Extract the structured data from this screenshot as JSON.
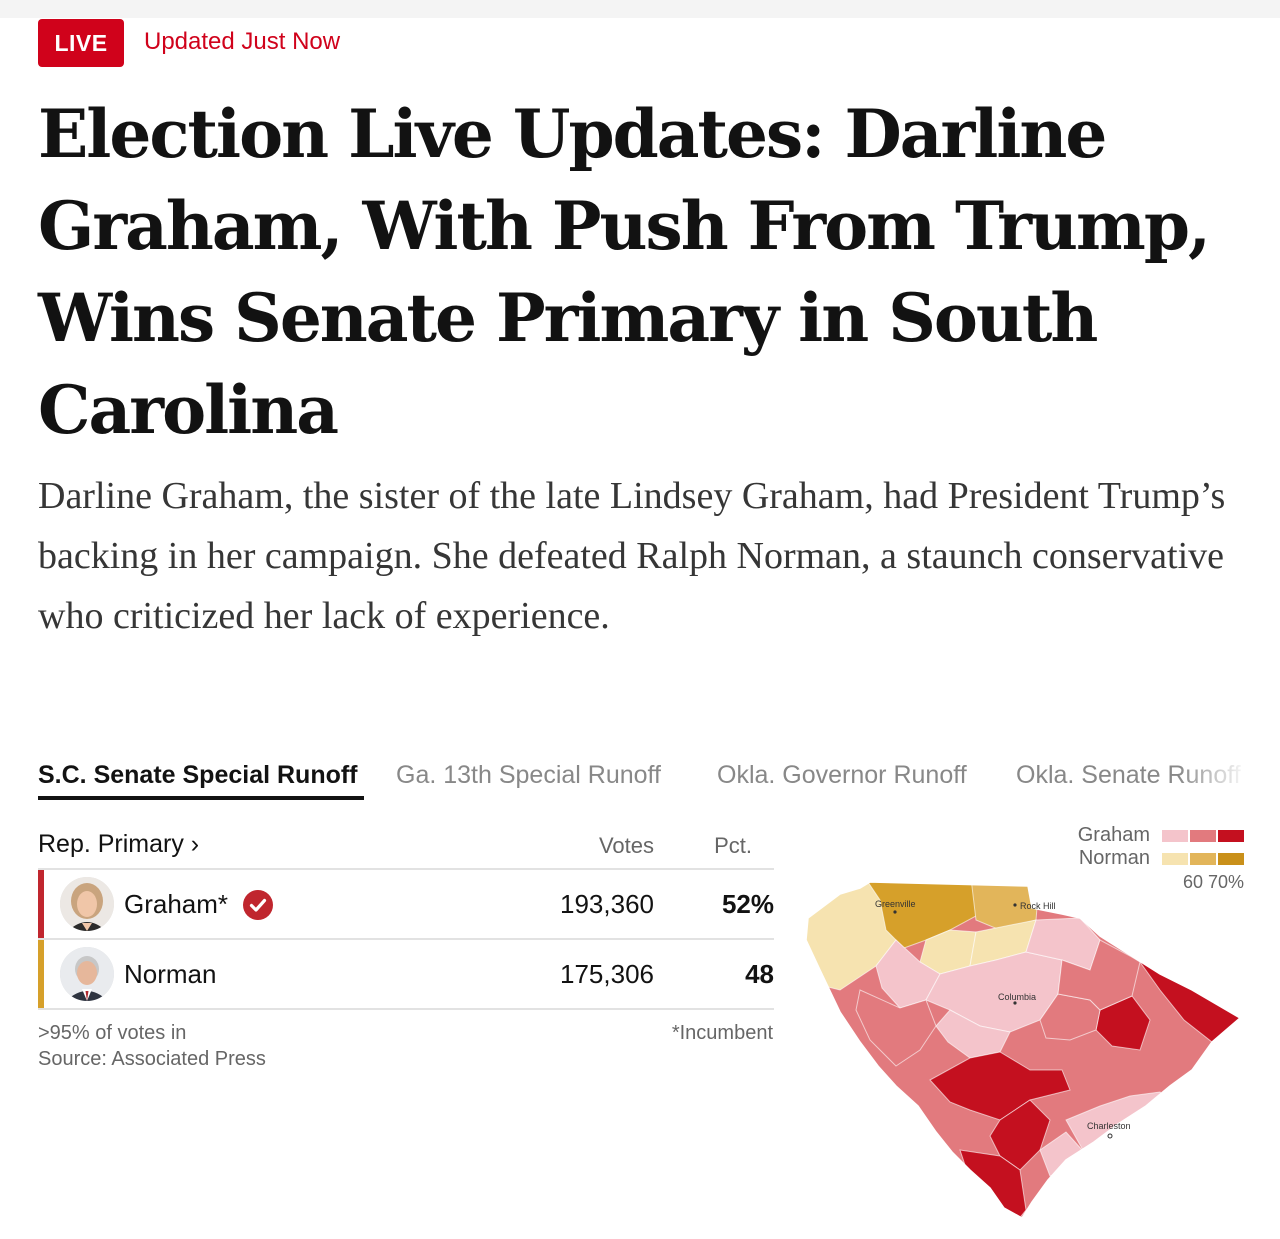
{
  "header": {
    "live_badge": "LIVE",
    "updated": "Updated Just Now"
  },
  "article": {
    "headline": "Election Live Updates: Darline Graham, With Push From Trump, Wins Senate Primary in South Carolina",
    "dek": "Darline Graham, the sister of the late Lindsey Graham, had President Trump’s backing in her campaign. She defeated Ralph Norman, a staunch conservative who criticized her lack of experience."
  },
  "race_tabs": [
    {
      "label": "S.C. Senate Special Runoff",
      "active": true
    },
    {
      "label": "Ga. 13th Special Runoff",
      "active": false
    },
    {
      "label": "Okla. Governor Runoff",
      "active": false
    },
    {
      "label": "Okla. Senate Runoff",
      "active": false
    }
  ],
  "results": {
    "primary_label": "Rep. Primary ›",
    "columns": {
      "votes": "Votes",
      "pct": "Pct."
    },
    "candidates": [
      {
        "name": "Graham*",
        "votes": "193,360",
        "pct": "52%",
        "winner": true,
        "color": "#c0262e"
      },
      {
        "name": "Norman",
        "votes": "175,306",
        "pct": "48",
        "winner": false,
        "color": "#d6a02a"
      }
    ],
    "reporting": ">95% of votes in",
    "source": "Source: Associated Press",
    "incumbent_note": "*Incumbent"
  },
  "map": {
    "legend": {
      "graham_label": "Graham",
      "norman_label": "Norman",
      "scale": "60 70%",
      "graham_colors": [
        "#f4c4cb",
        "#e27a7e",
        "#c4101f"
      ],
      "norman_colors": [
        "#f6e3b0",
        "#e2b55a",
        "#c9901a"
      ]
    },
    "cities": [
      "Greenville",
      "Rock Hill",
      "Columbia",
      "Charleston"
    ]
  }
}
